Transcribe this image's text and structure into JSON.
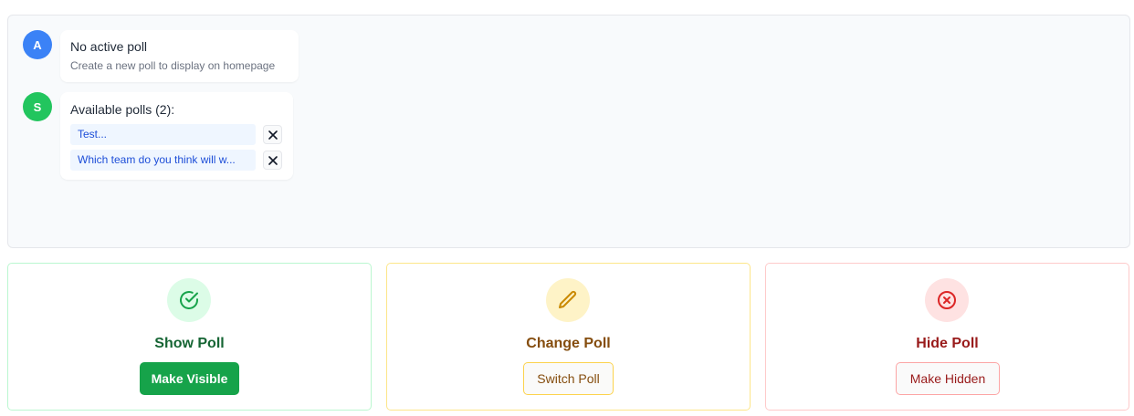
{
  "chat": {
    "messages": [
      {
        "avatar": "A",
        "title": "No active poll",
        "subtitle": "Create a new poll to display on homepage"
      },
      {
        "avatar": "S",
        "title": "Available polls (2):"
      }
    ],
    "polls": [
      {
        "label": "Test...",
        "remove_icon": "close-icon"
      },
      {
        "label": "Which team do you think will w...",
        "remove_icon": "close-icon"
      }
    ]
  },
  "actions": [
    {
      "title": "Show Poll",
      "button": "Make Visible",
      "icon": "check-circle-icon",
      "color": "#16a34a"
    },
    {
      "title": "Change Poll",
      "button": "Switch Poll",
      "icon": "pencil-icon",
      "color": "#ca8a04"
    },
    {
      "title": "Hide Poll",
      "button": "Make Hidden",
      "icon": "x-circle-icon",
      "color": "#dc2626"
    }
  ],
  "colors": {
    "avatar_a": "#3b82f6",
    "avatar_s": "#22c55e"
  }
}
